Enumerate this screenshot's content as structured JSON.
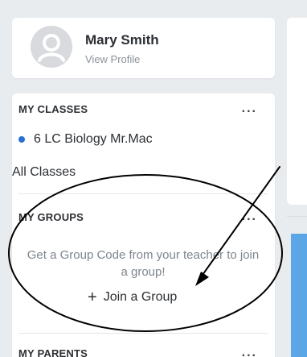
{
  "profile": {
    "name": "Mary Smith",
    "link_label": "View Profile"
  },
  "my_classes": {
    "title": "MY CLASSES",
    "more_label": "...",
    "items": [
      {
        "label": "6 LC Biology Mr.Mac",
        "dot_color": "#2a6fd6"
      }
    ],
    "all_label": "All Classes"
  },
  "my_groups": {
    "title": "MY GROUPS",
    "more_label": "...",
    "description": "Get a Group Code from your teacher to join a group!",
    "join_label": "Join a Group",
    "join_icon": "plus-icon"
  },
  "my_parents": {
    "title": "MY PARENTS",
    "more_label": "..."
  },
  "annotation": {
    "shapes": [
      "ellipse",
      "arrow"
    ],
    "color": "#000000"
  },
  "colors": {
    "accent": "#2a6fd6",
    "background": "#e9ecef",
    "card": "#ffffff",
    "muted_text": "#7d858d"
  }
}
